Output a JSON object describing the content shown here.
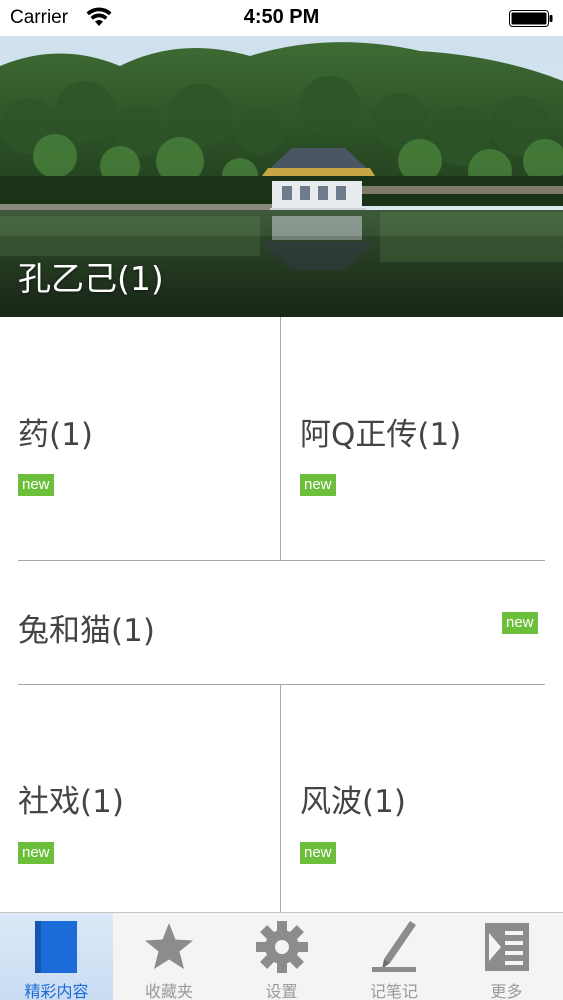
{
  "status_bar": {
    "carrier": "Carrier",
    "time": "4:50 PM",
    "icons": [
      "wifi-icon",
      "battery-icon"
    ]
  },
  "hero": {
    "title": "孔乙己(1)",
    "image": "lake-pavilion-photo"
  },
  "items": [
    {
      "title": "药(1)",
      "badge": "new"
    },
    {
      "title": "阿Q正传(1)",
      "badge": "new"
    },
    {
      "title": "兔和猫(1)",
      "badge": "new"
    },
    {
      "title": "社戏(1)",
      "badge": "new"
    },
    {
      "title": "风波(1)",
      "badge": "new"
    }
  ],
  "tab_bar": {
    "tabs": [
      {
        "label": "精彩内容",
        "icon": "book-icon",
        "active": true
      },
      {
        "label": "收藏夹",
        "icon": "star-icon",
        "active": false
      },
      {
        "label": "设置",
        "icon": "gear-icon",
        "active": false
      },
      {
        "label": "记笔记",
        "icon": "pen-icon",
        "active": false
      },
      {
        "label": "更多",
        "icon": "more-icon",
        "active": false
      }
    ]
  },
  "colors": {
    "badge": "#6cbf3a",
    "active_tab": "#1b6bd8",
    "inactive_tab": "#9a9a9a",
    "divider": "#a8a8a8"
  }
}
